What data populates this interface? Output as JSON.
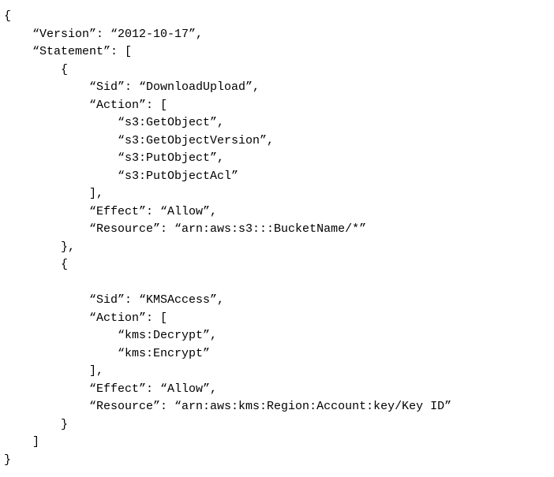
{
  "code": {
    "open_brace": "{",
    "version_line": "    “Version”: “2012-10-17”,",
    "statement_open": "    “Statement”: [",
    "obj1_open": "        {",
    "obj1_sid": "            “Sid”: “DownloadUpload”,",
    "obj1_action_open": "            “Action”: [",
    "obj1_action_1": "                “s3:GetObject”,",
    "obj1_action_2": "                “s3:GetObjectVersion”,",
    "obj1_action_3": "                “s3:PutObject”,",
    "obj1_action_4": "                “s3:PutObjectAcl”",
    "obj1_action_close": "            ],",
    "obj1_effect": "            “Effect”: “Allow”,",
    "obj1_resource": "            “Resource”: “arn:aws:s3:::BucketName/*”",
    "obj1_close": "        },",
    "obj2_open": "        {",
    "blank": "",
    "obj2_sid": "            “Sid”: “KMSAccess”,",
    "obj2_action_open": "            “Action”: [",
    "obj2_action_1": "                “kms:Decrypt”,",
    "obj2_action_2": "                “kms:Encrypt”",
    "obj2_action_close": "            ],",
    "obj2_effect": "            “Effect”: “Allow”,",
    "obj2_resource": "            “Resource”: “arn:aws:kms:Region:Account:key/Key ID”",
    "obj2_close": "        }",
    "statement_close": "    ]",
    "close_brace": "}"
  }
}
